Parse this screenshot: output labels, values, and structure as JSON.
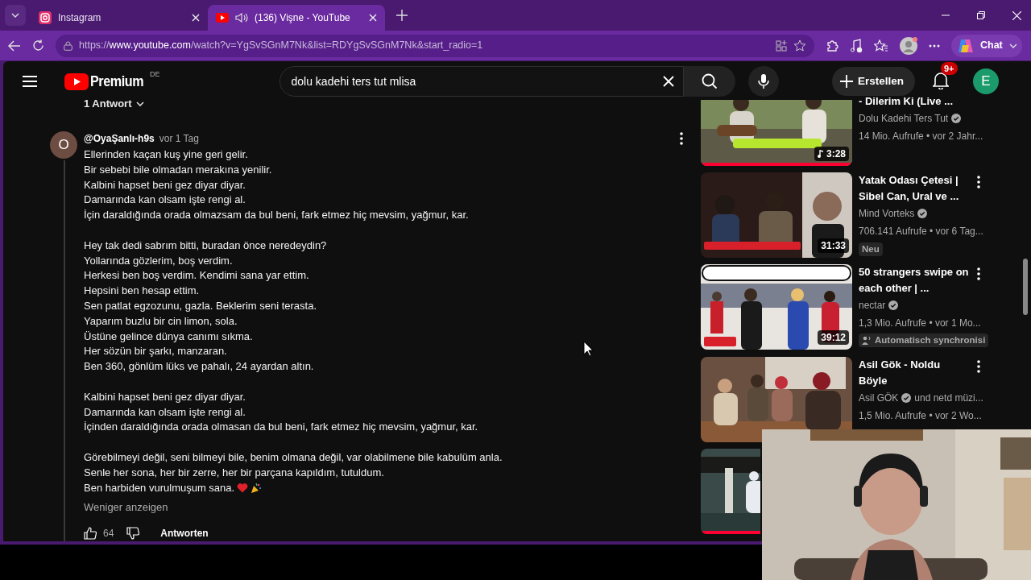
{
  "browser": {
    "tabs": [
      {
        "title": "Instagram",
        "kind": "instagram",
        "selected": false,
        "audio": false
      },
      {
        "title": "(136) Vişne - YouTube",
        "kind": "youtube",
        "selected": true,
        "audio": true
      }
    ],
    "url": {
      "scheme": "https://",
      "host": "www.youtube.com",
      "path": "/watch?v=YgSvSGnM7Nk&list=RDYgSvSGnM7Nk&start_radio=1"
    },
    "chat_label": "Chat"
  },
  "header": {
    "logo": "Premium",
    "region": "DE",
    "search_value": "dolu kadehi ters tut mlisa",
    "create_label": "Erstellen",
    "notifications": "9+",
    "avatar": "E"
  },
  "comment": {
    "replies_toggle": "1 Antwort",
    "author_initial": "O",
    "author": "@OyaŞanlı-h9s",
    "time": "vor 1 Tag",
    "stanzas": [
      [
        "Ellerinden kaçan kuş yine geri gelir.",
        "Bir sebebi bile olmadan merakına yenilir.",
        "Kalbini hapset beni gez diyar diyar.",
        "Damarında kan olsam işte rengi al.",
        "İçin daraldığında orada olmazsam da bul beni, fark etmez hiç mevsim, yağmur, kar."
      ],
      [
        "Hey tak dedi sabrım bitti, buradan önce neredeydin?",
        "Yollarında gözlerim, boş verdim.",
        "Herkesi ben boş verdim. Kendimi sana yar ettim.",
        "Hepsini ben hesap ettim.",
        "Sen patlat egzozunu, gazla. Beklerim seni terasta.",
        "Yaparım buzlu bir cin limon, sola.",
        "Üstüne gelince dünya canımı sıkma.",
        "Her sözün bir şarkı, manzaran.",
        "Ben 360, gönlüm lüks ve pahalı, 24 ayardan altın."
      ],
      [
        "Kalbini hapset beni gez diyar diyar.",
        "Damarında kan olsam işte rengi al.",
        "İçinden daraldığında orada olmasan da bul beni, fark etmez hiç mevsim, yağmur, kar."
      ],
      [
        "Görebilmeyi değil, seni bilmeyi bile, benim olmana değil, var olabilmene bile kabulüm anla.",
        "Senle her sona, her bir zerre, her bir parçana kapıldım, tutuldum.",
        "Ben harbiden vurulmuşum sana."
      ]
    ],
    "show_less": "Weniger anzeigen",
    "likes": "64",
    "reply": "Antworten"
  },
  "videos": [
    {
      "title": "- Dilerim Ki (Live ...",
      "channel": "Dolu Kadehi Ters Tut",
      "verified": true,
      "meta": "14 Mio. Aufrufe • vor 2 Jahr...",
      "duration": "3:28",
      "watched": {
        "level": 1
      }
    },
    {
      "title": "Yatak Odası Çetesi | Sibel Can, Ural ve ...",
      "channel": "Mind Vorteks",
      "verified": true,
      "meta": "706.141 Aufrufe • vor 6 Tag...",
      "duration": "31:33",
      "badge": {
        "kind": "new",
        "text": "Neu"
      }
    },
    {
      "title": "50 strangers swipe on each other | ...",
      "channel": "nectar",
      "verified": true,
      "meta": "1,3 Mio. Aufrufe • vor 1 Mo...",
      "duration": "39:12",
      "badge": {
        "kind": "dubbed",
        "text": "Automatisch synchronisi"
      }
    },
    {
      "title": "Asil Gök - Noldu Böyle",
      "channel": "Asil GÖK",
      "verified": true,
      "channel_suffix": "und netd müzi...",
      "meta": "1,5 Mio. Aufrufe • vor 2 Wo..."
    },
    {
      "watched": {
        "level": 1
      }
    }
  ]
}
